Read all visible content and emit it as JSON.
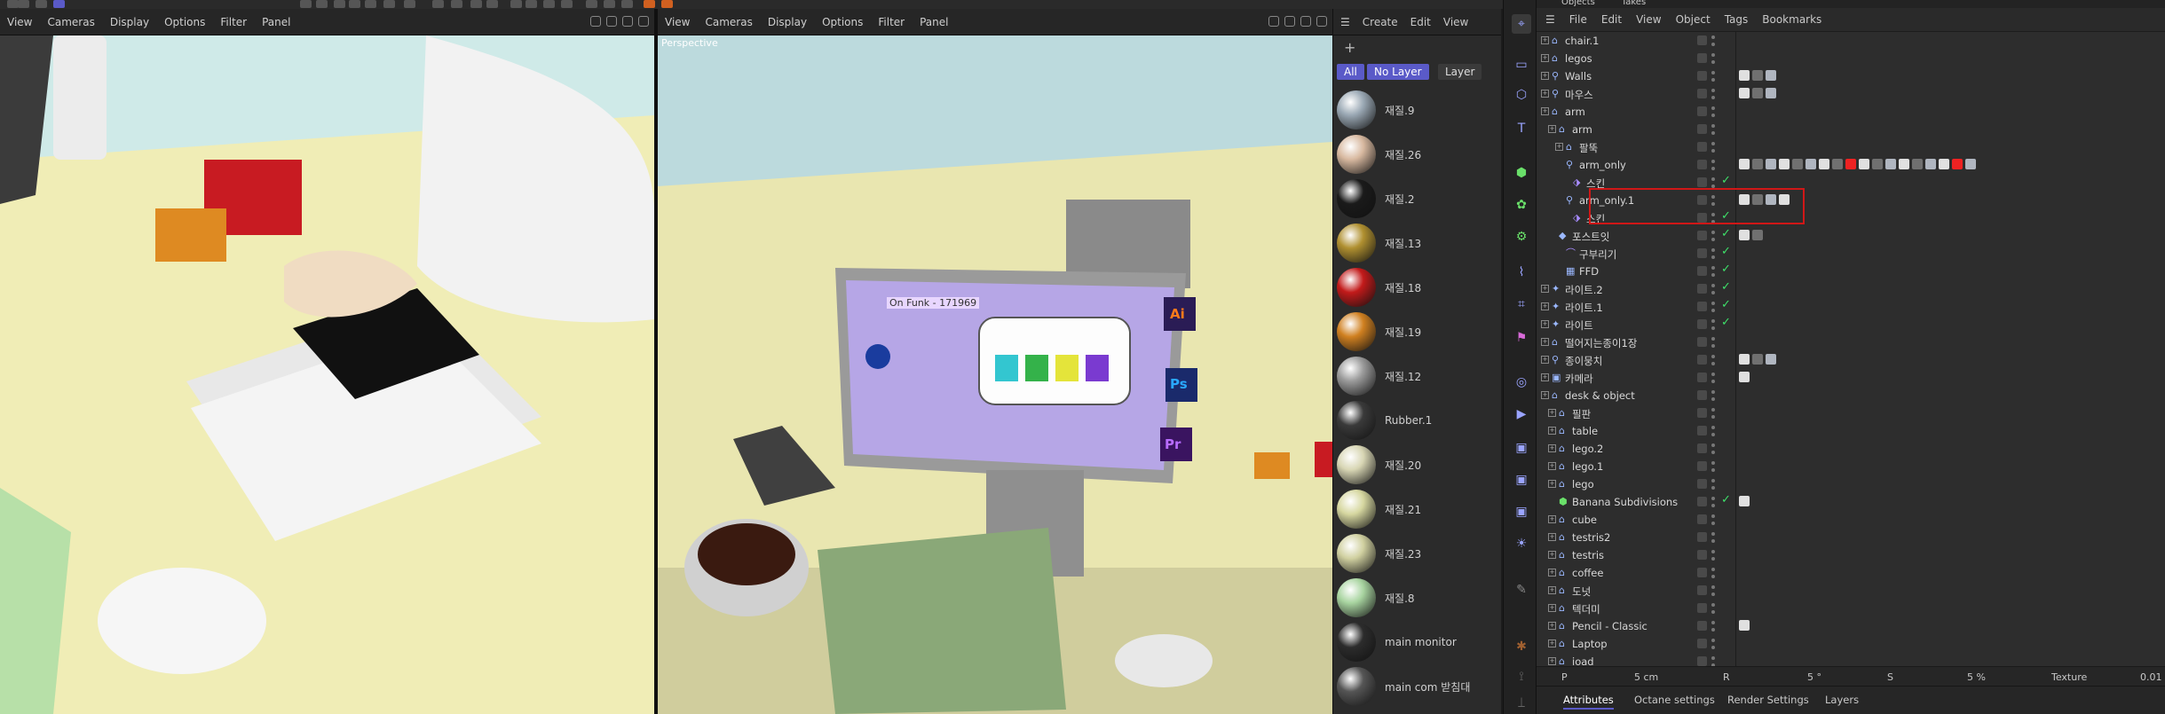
{
  "left_viewport": {
    "menu": [
      "View",
      "Cameras",
      "Display",
      "Options",
      "Filter",
      "Panel"
    ]
  },
  "main_viewport": {
    "menu": [
      "View",
      "Cameras",
      "Display",
      "Options",
      "Filter",
      "Panel"
    ],
    "label": "Perspective",
    "monitor_song": "On Funk - 171969",
    "app_icons": [
      "Ai",
      "Ps",
      "Pr"
    ]
  },
  "materials": {
    "menu": [
      "Create",
      "Edit",
      "View"
    ],
    "filters": [
      "All",
      "No Layer",
      "Layer"
    ],
    "items": [
      {
        "name": "재질.9",
        "color": "#9aa8b4"
      },
      {
        "name": "재질.26",
        "color": "#d8b9a0"
      },
      {
        "name": "재질.2",
        "color": "#1a1a1a"
      },
      {
        "name": "재질.13",
        "color": "#b09030"
      },
      {
        "name": "재질.18",
        "color": "#c21a1a"
      },
      {
        "name": "재질.19",
        "color": "#d08020"
      },
      {
        "name": "재질.12",
        "color": "#9a9a9a"
      },
      {
        "name": "Rubber.1",
        "color": "#3a3a3a"
      },
      {
        "name": "재질.20",
        "color": "#d8d6b4"
      },
      {
        "name": "재질.21",
        "color": "#d6d7a0"
      },
      {
        "name": "재질.23",
        "color": "#d0d0a0"
      },
      {
        "name": "재질.8",
        "color": "#a8d4a0"
      },
      {
        "name": "main monitor",
        "color": "#2c2c2c"
      },
      {
        "name": "main com 받침대",
        "color": "#555555"
      }
    ]
  },
  "object_manager": {
    "tabs": [
      "Objects",
      "Takes"
    ],
    "menu": [
      "File",
      "Edit",
      "View",
      "Object",
      "Tags",
      "Bookmarks"
    ],
    "rows": [
      {
        "label": "chair.1",
        "indent": 0,
        "icon": "null"
      },
      {
        "label": "legos",
        "indent": 0,
        "icon": "null"
      },
      {
        "label": "Walls",
        "indent": 0,
        "icon": "bone"
      },
      {
        "label": "마우스",
        "indent": 0,
        "icon": "bone"
      },
      {
        "label": "arm",
        "indent": 0,
        "icon": "null"
      },
      {
        "label": "arm",
        "indent": 1,
        "icon": "null"
      },
      {
        "label": "팔뚝",
        "indent": 2,
        "icon": "null"
      },
      {
        "label": "arm_only",
        "indent": 2,
        "icon": "bone"
      },
      {
        "label": "스킨",
        "indent": 3,
        "icon": "skin"
      },
      {
        "label": "arm_only.1",
        "indent": 2,
        "icon": "bone"
      },
      {
        "label": "스킨",
        "indent": 3,
        "icon": "skin"
      },
      {
        "label": "포스트잇",
        "indent": 1,
        "icon": "poly"
      },
      {
        "label": "구부리기",
        "indent": 2,
        "icon": "deform"
      },
      {
        "label": "FFD",
        "indent": 2,
        "icon": "ffd"
      },
      {
        "label": "라이트.2",
        "indent": 0,
        "icon": "light"
      },
      {
        "label": "라이트.1",
        "indent": 0,
        "icon": "light"
      },
      {
        "label": "라이트",
        "indent": 0,
        "icon": "light"
      },
      {
        "label": "떨어지는종이1장",
        "indent": 0,
        "icon": "null"
      },
      {
        "label": "종이뭉치",
        "indent": 0,
        "icon": "bone"
      },
      {
        "label": "카메라",
        "indent": 0,
        "icon": "camera"
      },
      {
        "label": "desk & object",
        "indent": 0,
        "icon": "null"
      },
      {
        "label": "필판",
        "indent": 1,
        "icon": "null"
      },
      {
        "label": "table",
        "indent": 1,
        "icon": "null"
      },
      {
        "label": "lego.2",
        "indent": 1,
        "icon": "null"
      },
      {
        "label": "lego.1",
        "indent": 1,
        "icon": "null"
      },
      {
        "label": "lego",
        "indent": 1,
        "icon": "null"
      },
      {
        "label": "Banana Subdivisions",
        "indent": 1,
        "icon": "subd"
      },
      {
        "label": "cube",
        "indent": 1,
        "icon": "null"
      },
      {
        "label": "testris2",
        "indent": 1,
        "icon": "null"
      },
      {
        "label": "testris",
        "indent": 1,
        "icon": "null"
      },
      {
        "label": "coffee",
        "indent": 1,
        "icon": "null"
      },
      {
        "label": "도넛",
        "indent": 1,
        "icon": "null"
      },
      {
        "label": "텍더미",
        "indent": 1,
        "icon": "null"
      },
      {
        "label": "Pencil - Classic",
        "indent": 1,
        "icon": "null"
      },
      {
        "label": "Laptop",
        "indent": 1,
        "icon": "null"
      },
      {
        "label": "ioad",
        "indent": 1,
        "icon": "null"
      }
    ],
    "coords": {
      "p_label": "P",
      "p_value": "5 cm",
      "r_label": "R",
      "r_value": "5 °",
      "s_label": "S",
      "s_value": "5 %",
      "texture_label": "Texture",
      "texture_value": "0.01"
    },
    "bottom_tabs": [
      "Attributes",
      "Octane settings",
      "Render Settings",
      "Layers"
    ]
  },
  "colors": {
    "accent": "#5858d8",
    "highlight": "#d01717",
    "check": "#3ee06a"
  }
}
